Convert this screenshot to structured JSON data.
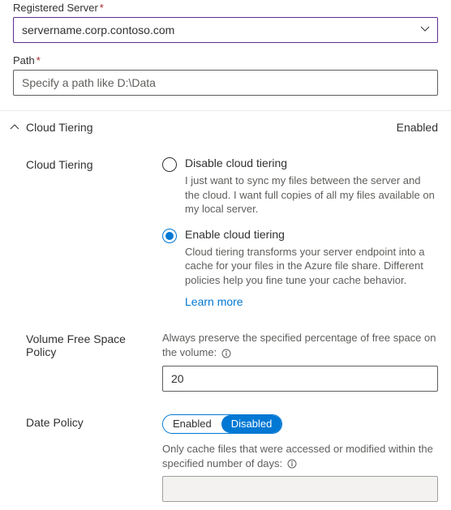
{
  "registeredServer": {
    "label": "Registered Server",
    "value": "servername.corp.contoso.com"
  },
  "path": {
    "label": "Path",
    "placeholder": "Specify a path like D:\\Data",
    "value": ""
  },
  "section": {
    "title": "Cloud Tiering",
    "status": "Enabled"
  },
  "cloudTiering": {
    "label": "Cloud Tiering",
    "disable": {
      "title": "Disable cloud tiering",
      "desc": "I just want to sync my files between the server and the cloud. I want full copies of all my files available on my local server."
    },
    "enable": {
      "title": "Enable cloud tiering",
      "desc": "Cloud tiering transforms your server endpoint into a cache for your files in the Azure file share. Different policies help you fine tune your cache behavior."
    },
    "learnMore": "Learn more"
  },
  "volumePolicy": {
    "label": "Volume Free Space Policy",
    "desc": "Always preserve the specified percentage of free space on the volume:",
    "value": "20"
  },
  "datePolicy": {
    "label": "Date Policy",
    "enabled": "Enabled",
    "disabled": "Disabled",
    "desc": "Only cache files that were accessed or modified within the specified number of days:",
    "value": ""
  }
}
